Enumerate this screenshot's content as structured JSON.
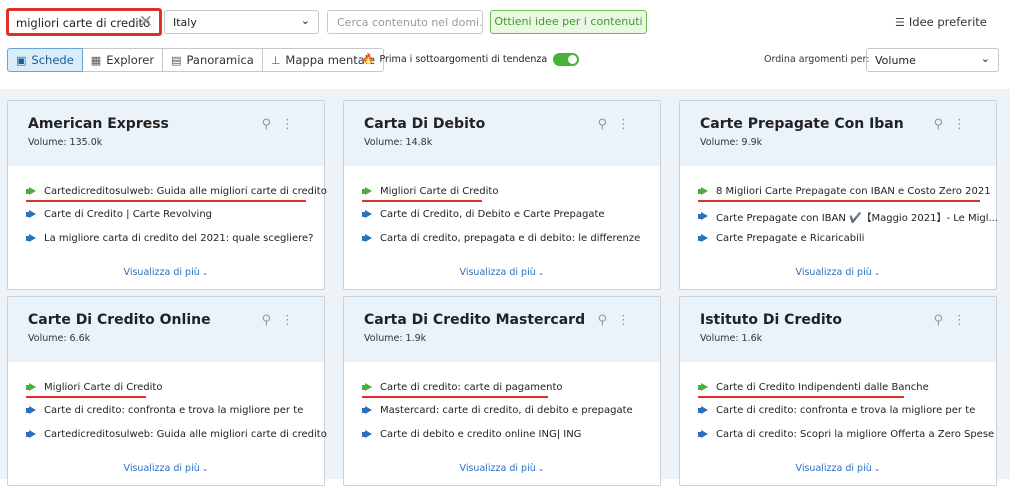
{
  "search": {
    "value": "migliori carte di credito",
    "clear_icon": "close-icon"
  },
  "country": {
    "value": "Italy"
  },
  "domain": {
    "placeholder": "Cerca contenuto nel domi..."
  },
  "ideas_button": {
    "label": "Ottieni idee per i contenuti"
  },
  "favorites": {
    "label": "Idee preferite",
    "icon": "list-icon"
  },
  "view_tabs": [
    {
      "label": "Schede",
      "icon": "cards-icon",
      "active": true
    },
    {
      "label": "Explorer",
      "icon": "table-icon",
      "active": false
    },
    {
      "label": "Panoramica",
      "icon": "overview-icon",
      "active": false
    },
    {
      "label": "Mappa mentale",
      "icon": "mindmap-icon",
      "active": false
    }
  ],
  "trending": {
    "label": "Prima i sottoargomenti di tendenza",
    "enabled": true
  },
  "sort": {
    "label": "Ordina argomenti per:",
    "value": "Volume"
  },
  "colors": {
    "accent_green": "#49b03a",
    "link_blue": "#2d6ebd",
    "highlight_red": "#e0322a",
    "card_header": "#eaf2fa"
  },
  "more_label": "Visualizza di più",
  "cards": [
    {
      "title": "American Express",
      "volume": "Volume: 135.0k",
      "links": [
        {
          "text": "Cartedicreditosulweb: Guida alle migliori carte di credito",
          "trending": true,
          "highlighted": true
        },
        {
          "text": "Carte di Credito | Carte Revolving",
          "trending": false,
          "highlighted": false
        },
        {
          "text": "La migliore carta di credito del 2021: quale scegliere?",
          "trending": false,
          "highlighted": false
        }
      ]
    },
    {
      "title": "Carta Di Debito",
      "volume": "Volume: 14.8k",
      "links": [
        {
          "text": "Migliori Carte di Credito",
          "trending": true,
          "highlighted": true
        },
        {
          "text": "Carte di Credito, di Debito e Carte Prepagate",
          "trending": false,
          "highlighted": false
        },
        {
          "text": "Carta di credito, prepagata e di debito: le differenze",
          "trending": false,
          "highlighted": false
        }
      ]
    },
    {
      "title": "Carte Prepagate Con Iban",
      "volume": "Volume: 9.9k",
      "links": [
        {
          "text": "8 Migliori Carte Prepagate con IBAN e Costo Zero 2021",
          "trending": true,
          "highlighted": true
        },
        {
          "text": "Carte Prepagate con IBAN ✔️【Maggio 2021】- Le Migl...",
          "trending": false,
          "highlighted": false
        },
        {
          "text": "Carte Prepagate e Ricaricabili",
          "trending": false,
          "highlighted": false
        }
      ]
    },
    {
      "title": "Carte Di Credito Online",
      "volume": "Volume: 6.6k",
      "links": [
        {
          "text": "Migliori Carte di Credito",
          "trending": true,
          "highlighted": true
        },
        {
          "text": "Carte di credito: confronta e trova la migliore per te",
          "trending": false,
          "highlighted": false
        },
        {
          "text": "Cartedicreditosulweb: Guida alle migliori carte di credito",
          "trending": false,
          "highlighted": false
        }
      ]
    },
    {
      "title": "Carta Di Credito Mastercard",
      "volume": "Volume: 1.9k",
      "links": [
        {
          "text": "Carte di credito: carte di pagamento",
          "trending": true,
          "highlighted": true
        },
        {
          "text": "Mastercard: carte di credito, di debito e prepagate",
          "trending": false,
          "highlighted": false
        },
        {
          "text": "Carte di debito e credito online ING| ING",
          "trending": false,
          "highlighted": false
        }
      ]
    },
    {
      "title": "Istituto Di Credito",
      "volume": "Volume: 1.6k",
      "links": [
        {
          "text": "Carte di Credito Indipendenti dalle Banche",
          "trending": true,
          "highlighted": true
        },
        {
          "text": "Carte di credito: confronta e trova la migliore per te",
          "trending": false,
          "highlighted": false
        },
        {
          "text": "Carta di credito: Scopri la migliore Offerta a Zero Spese",
          "trending": false,
          "highlighted": false
        }
      ]
    }
  ]
}
